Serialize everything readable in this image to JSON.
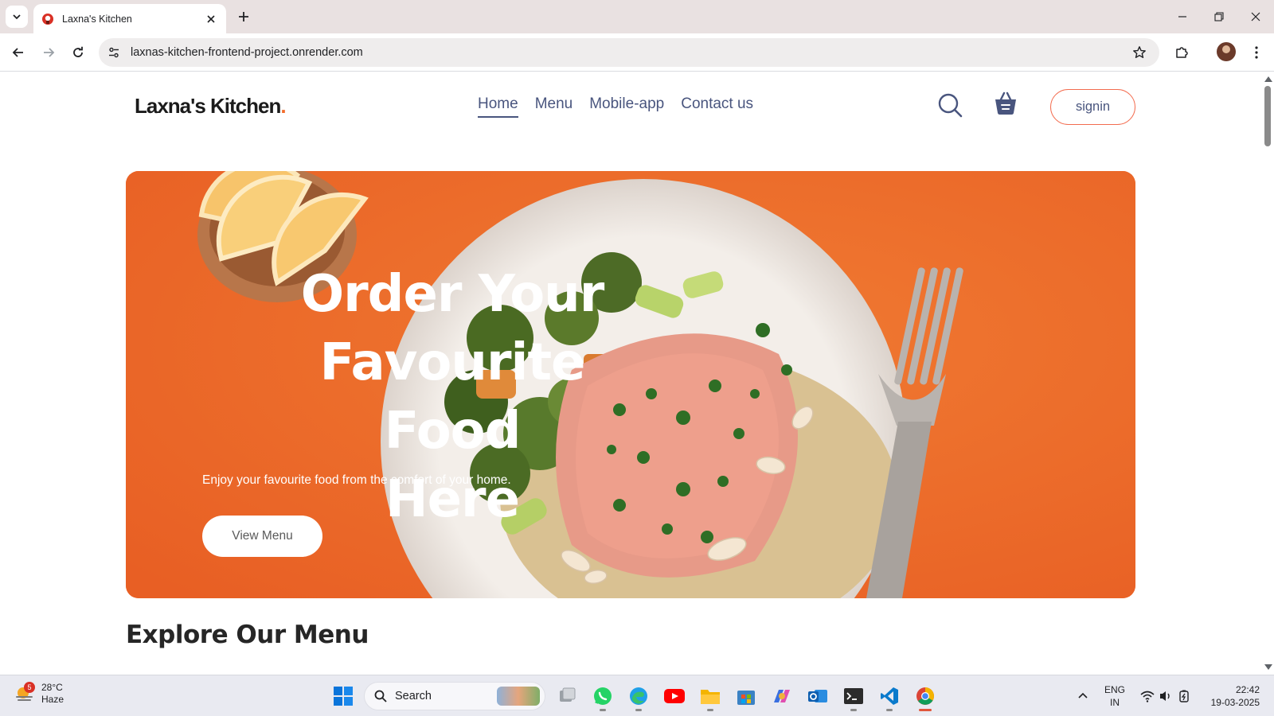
{
  "browser": {
    "tab_title": "Laxna's Kitchen",
    "url": "laxnas-kitchen-frontend-project.onrender.com"
  },
  "site": {
    "logo_text": "Laxna's Kitchen",
    "logo_dot": ".",
    "nav": [
      "Home",
      "Menu",
      "Mobile-app",
      "Contact us"
    ],
    "active_nav": "Home",
    "signin_label": "signin",
    "accent_color": "#f36c4f",
    "nav_color": "#49557e"
  },
  "hero": {
    "title_line1": "Order Your",
    "title_line2": "Favourite Food",
    "title_line3": "Here",
    "subtitle": "Enjoy your favourite food from the comfort of your home.",
    "button_label": "View Menu",
    "background_color": "#ee6a2c"
  },
  "explore": {
    "heading": "Explore Our Menu"
  },
  "taskbar": {
    "weather_temp": "28°C",
    "weather_desc": "Haze",
    "weather_badge": "5",
    "search_label": "Search",
    "apps": [
      "task-view-icon",
      "whatsapp-icon",
      "edge-icon",
      "youtube-icon",
      "file-explorer-icon",
      "ms-store-icon",
      "copilot-icon",
      "outlook-icon",
      "terminal-icon",
      "vscode-icon",
      "chrome-icon"
    ],
    "lang_line1": "ENG",
    "lang_line2": "IN",
    "time": "22:42",
    "date": "19-03-2025"
  }
}
